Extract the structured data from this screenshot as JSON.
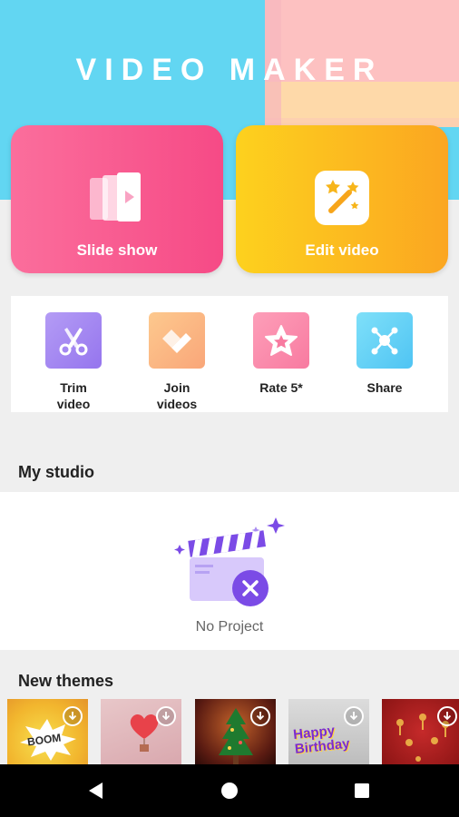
{
  "header": {
    "title": "VIDEO MAKER"
  },
  "main_cards": [
    {
      "label": "Slide show",
      "icon": "slideshow-icon"
    },
    {
      "label": "Edit video",
      "icon": "magic-wand-icon"
    }
  ],
  "tools": [
    {
      "label": "Trim\nvideo",
      "icon": "scissors-icon"
    },
    {
      "label": "Join\nvideos",
      "icon": "join-icon"
    },
    {
      "label": "Rate 5*",
      "icon": "star-icon"
    },
    {
      "label": "Share",
      "icon": "share-icon"
    }
  ],
  "studio": {
    "title": "My studio",
    "empty_text": "No Project"
  },
  "themes": {
    "title": "New themes",
    "items": [
      {
        "text": "BOOM",
        "icon": "download-icon"
      },
      {
        "text": "",
        "icon": "download-icon"
      },
      {
        "text": "",
        "icon": "download-icon"
      },
      {
        "text": "Happy Birthday",
        "icon": "download-icon"
      },
      {
        "text": "",
        "icon": "download-icon"
      }
    ]
  },
  "colors": {
    "header_bg": "#62d6f2",
    "slide_card": "#f64a86",
    "edit_card": "#fba621",
    "accent_purple": "#7b4be6"
  },
  "navigation": [
    {
      "icon": "back-icon"
    },
    {
      "icon": "home-icon"
    },
    {
      "icon": "recents-icon"
    }
  ]
}
